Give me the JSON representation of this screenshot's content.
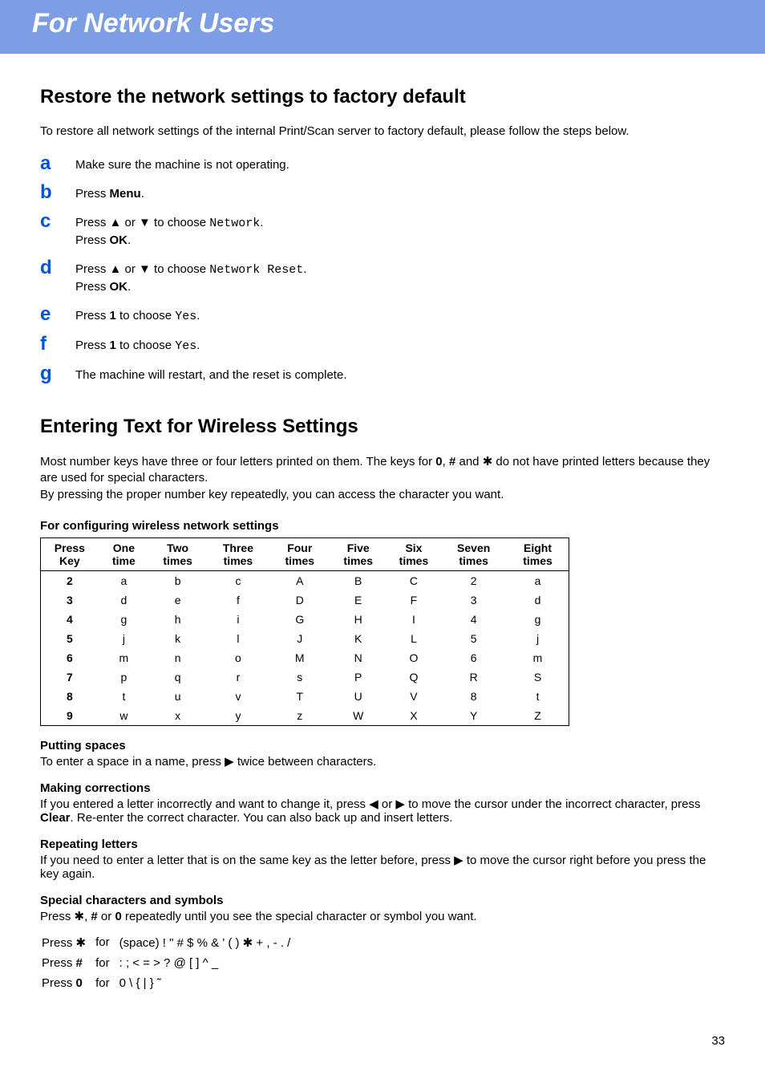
{
  "banner": {
    "title": "For Network Users"
  },
  "section1": {
    "heading": "Restore the network settings to factory default",
    "intro": "To restore all network settings of the internal Print/Scan server to factory default, please follow the steps below.",
    "steps": {
      "a": {
        "letter": "a",
        "text": "Make sure the machine is not operating."
      },
      "b": {
        "letter": "b",
        "prefix": "Press ",
        "bold": "Menu",
        "suffix": "."
      },
      "c": {
        "letter": "c",
        "line1_prefix": "Press ▲ or ▼ to choose ",
        "line1_mono": "Network",
        "line1_suffix": ".",
        "line2_prefix": "Press ",
        "line2_bold": "OK",
        "line2_suffix": "."
      },
      "d": {
        "letter": "d",
        "line1_prefix": "Press ▲ or ▼ to choose ",
        "line1_mono": "Network Reset",
        "line1_suffix": ".",
        "line2_prefix": "Press ",
        "line2_bold": "OK",
        "line2_suffix": "."
      },
      "e": {
        "letter": "e",
        "prefix": "Press ",
        "bold": "1",
        "mid": "  to choose ",
        "mono": "Yes",
        "suffix": "."
      },
      "f": {
        "letter": "f",
        "prefix": "Press ",
        "bold": "1",
        "mid": "  to choose ",
        "mono": "Yes",
        "suffix": "."
      },
      "g": {
        "letter": "g",
        "text": "The machine will restart, and the reset is complete."
      }
    }
  },
  "section2": {
    "heading": "Entering Text for Wireless Settings",
    "para1_a": "Most number keys have three or four letters printed on them. The keys for ",
    "para1_b0": "0",
    "para1_sep1": ", ",
    "para1_b1": "#",
    "para1_mid": " and ✱ do not have printed letters because they are used for special characters.",
    "para2": "By pressing the proper number key repeatedly, you can access the character you want.",
    "table_title": "For configuring wireless network settings"
  },
  "chart_data": {
    "type": "table",
    "headers": [
      "Press Key",
      "One time",
      "Two times",
      "Three times",
      "Four times",
      "Five times",
      "Six times",
      "Seven times",
      "Eight times"
    ],
    "rows": [
      [
        "2",
        "a",
        "b",
        "c",
        "A",
        "B",
        "C",
        "2",
        "a"
      ],
      [
        "3",
        "d",
        "e",
        "f",
        "D",
        "E",
        "F",
        "3",
        "d"
      ],
      [
        "4",
        "g",
        "h",
        "i",
        "G",
        "H",
        "I",
        "4",
        "g"
      ],
      [
        "5",
        "j",
        "k",
        "l",
        "J",
        "K",
        "L",
        "5",
        "j"
      ],
      [
        "6",
        "m",
        "n",
        "o",
        "M",
        "N",
        "O",
        "6",
        "m"
      ],
      [
        "7",
        "p",
        "q",
        "r",
        "s",
        "P",
        "Q",
        "R",
        "S"
      ],
      [
        "8",
        "t",
        "u",
        "v",
        "T",
        "U",
        "V",
        "8",
        "t"
      ],
      [
        "9",
        "w",
        "x",
        "y",
        "z",
        "W",
        "X",
        "Y",
        "Z"
      ]
    ]
  },
  "putting_spaces": {
    "heading": "Putting spaces",
    "text": "To enter a space in a name, press ▶ twice between characters."
  },
  "making_corrections": {
    "heading": "Making corrections",
    "prefix": "If you entered a letter incorrectly and want to change it, press ◀ or ▶ to move the cursor under the incorrect character, press ",
    "bold": "Clear",
    "suffix": ". Re-enter the correct character. You can also back up and insert letters."
  },
  "repeating": {
    "heading": "Repeating letters",
    "text": "If you need to enter a letter that is on the same key as the letter before, press ▶ to move the cursor right before you press the key again."
  },
  "special": {
    "heading": "Special characters and symbols",
    "line_prefix": "Press ✱, ",
    "line_b1": "#",
    "line_mid": " or ",
    "line_b2": "0",
    "line_suffix": " repeatedly until you see the special character or symbol you want.",
    "rows": [
      {
        "key_prefix": "Press ",
        "key": "✱",
        "for": "for",
        "chars": "(space) ! \" # $ % & ' ( ) ✱ + , - . /"
      },
      {
        "key_prefix": "Press ",
        "key_bold": "#",
        "for": "for",
        "chars": ": ; < = > ? @ [ ] ^ _"
      },
      {
        "key_prefix": "Press ",
        "key_bold": "0",
        "for": "for",
        "chars": "0 \\ { | } ˜"
      }
    ]
  },
  "page_number": "33"
}
